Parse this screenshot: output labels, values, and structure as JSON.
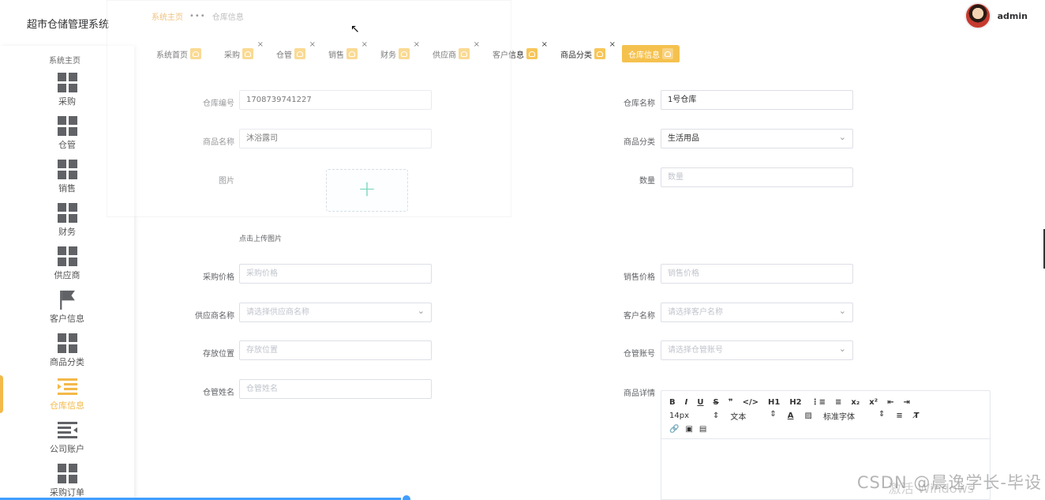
{
  "app": {
    "title": "超市仓储管理系统"
  },
  "header": {
    "breadcrumb_home": "系统主页",
    "breadcrumb_sep": "•••",
    "breadcrumb_current": "仓库信息",
    "username": "admin"
  },
  "sidebar": {
    "partial_top": "系统主页",
    "items": [
      {
        "label": "采购"
      },
      {
        "label": "仓管"
      },
      {
        "label": "销售"
      },
      {
        "label": "财务"
      },
      {
        "label": "供应商"
      },
      {
        "label": "客户信息"
      },
      {
        "label": "商品分类"
      },
      {
        "label": "仓库信息"
      },
      {
        "label": "公司账户"
      },
      {
        "label": "采购订单"
      }
    ]
  },
  "tabs": [
    {
      "label": "系统首页"
    },
    {
      "label": "采购"
    },
    {
      "label": "仓管"
    },
    {
      "label": "销售"
    },
    {
      "label": "财务"
    },
    {
      "label": "供应商"
    },
    {
      "label": "客户信息"
    },
    {
      "label": "商品分类"
    },
    {
      "label": "仓库信息"
    }
  ],
  "form": {
    "warehouse_no": {
      "label": "仓库编号",
      "value": "1708739741227"
    },
    "warehouse_name": {
      "label": "仓库名称",
      "value": "1号仓库"
    },
    "product_name": {
      "label": "商品名称",
      "value": "沐浴露司"
    },
    "category": {
      "label": "商品分类",
      "value": "生活用品"
    },
    "image": {
      "label": "图片",
      "plus": "+",
      "hint": "点击上传图片"
    },
    "quantity": {
      "label": "数量",
      "placeholder": "数量"
    },
    "purchase_price": {
      "label": "采购价格",
      "placeholder": "采购价格"
    },
    "sale_price": {
      "label": "销售价格",
      "placeholder": "销售价格"
    },
    "supplier": {
      "label": "供应商名称",
      "placeholder": "请选择供应商名称"
    },
    "customer": {
      "label": "客户名称",
      "placeholder": "请选择客户名称"
    },
    "location": {
      "label": "存放位置",
      "placeholder": "存放位置"
    },
    "keeper_account": {
      "label": "仓管账号",
      "placeholder": "请选择仓管账号"
    },
    "keeper_name": {
      "label": "仓管姓名",
      "placeholder": "仓管姓名"
    },
    "detail": {
      "label": "商品详情"
    }
  },
  "editor": {
    "row1": [
      "B",
      "I",
      "U",
      "S",
      "❞",
      "</>",
      "H1",
      "H2",
      "⋮≡",
      "≡",
      "x₂",
      "x²",
      "⇤",
      "⇥"
    ],
    "font_size": "14px",
    "text_type": "文本",
    "font_family": "标准字体"
  },
  "overlay": {
    "watermark": "CSDN @晨逸学长-毕设",
    "activate": "激活 Windows"
  },
  "colors": {
    "accent": "#f5c14e",
    "upload_plus": "#38c1a0"
  }
}
